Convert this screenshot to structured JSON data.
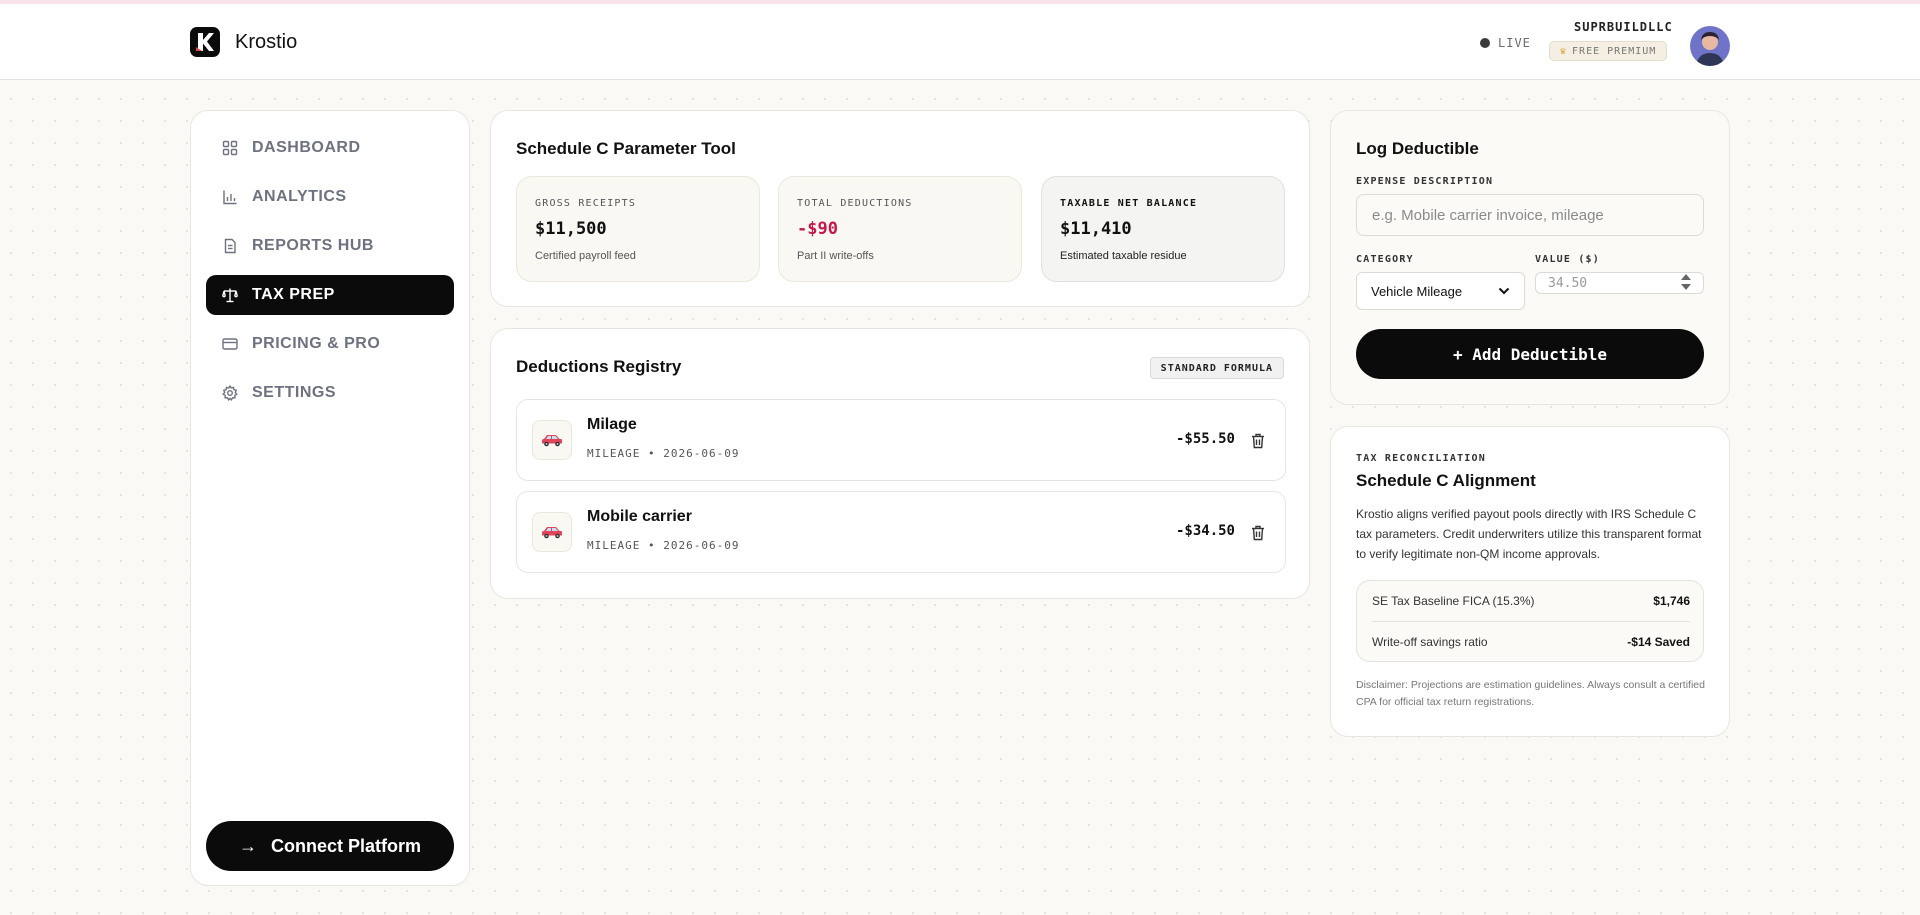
{
  "header": {
    "brand": "Krostio",
    "live_label": "LIVE",
    "user_name": "SUPRBUILDLLC",
    "plan_badge": "FREE PREMIUM"
  },
  "sidebar": {
    "items": [
      {
        "label": "DASHBOARD",
        "icon": "grid-icon"
      },
      {
        "label": "ANALYTICS",
        "icon": "bar-chart-icon"
      },
      {
        "label": "REPORTS HUB",
        "icon": "document-icon"
      },
      {
        "label": "TAX PREP",
        "icon": "scale-icon",
        "active": true
      },
      {
        "label": "PRICING & PRO",
        "icon": "credit-card-icon"
      },
      {
        "label": "SETTINGS",
        "icon": "gear-icon"
      }
    ],
    "connect_label": "Connect Platform"
  },
  "schedule": {
    "title": "Schedule C Parameter Tool",
    "stats": [
      {
        "label": "GROSS RECEIPTS",
        "value": "$11,500",
        "sub": "Certified payroll feed"
      },
      {
        "label": "TOTAL DEDUCTIONS",
        "value": "-$90",
        "sub": "Part II write-offs"
      },
      {
        "label": "TAXABLE NET BALANCE",
        "value": "$11,410",
        "sub": "Estimated taxable residue"
      }
    ]
  },
  "registry": {
    "title": "Deductions Registry",
    "badge": "STANDARD FORMULA",
    "entries": [
      {
        "title": "Milage",
        "meta": "MILEAGE • 2026-06-09",
        "amount": "-$55.50",
        "icon": "car-icon"
      },
      {
        "title": "Mobile carrier",
        "meta": "MILEAGE • 2026-06-09",
        "amount": "-$34.50",
        "icon": "car-icon"
      }
    ]
  },
  "log": {
    "title": "Log Deductible",
    "description_label": "EXPENSE DESCRIPTION",
    "description_placeholder": "e.g. Mobile carrier invoice, mileage",
    "category_label": "CATEGORY",
    "category_value": "Vehicle Mileage",
    "value_label": "VALUE ($)",
    "value_placeholder": "34.50",
    "add_label": "+ Add Deductible"
  },
  "reconciliation": {
    "eyebrow": "TAX RECONCILIATION",
    "title": "Schedule C Alignment",
    "text": "Krostio aligns verified payout pools directly with IRS Schedule C tax parameters. Credit underwriters utilize this transparent format to verify legitimate non-QM income approvals.",
    "rows": [
      {
        "label": "SE Tax Baseline FICA (15.3%)",
        "value": "$1,746"
      },
      {
        "label": "Write-off savings ratio",
        "value": "-$14 Saved"
      }
    ],
    "disclaimer": "Disclaimer: Projections are estimation guidelines. Always consult a certified CPA for official tax return registrations."
  },
  "colors": {
    "accent": "#0b0b0b",
    "negative": "#c5174a",
    "background": "#faf9f5"
  }
}
